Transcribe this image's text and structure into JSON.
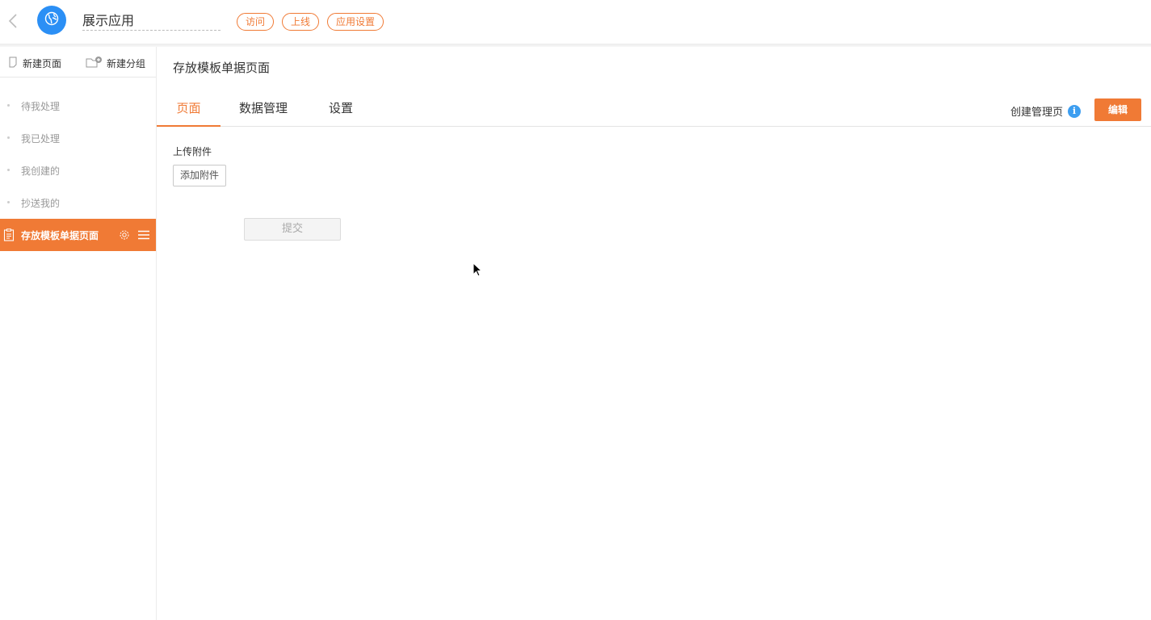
{
  "header": {
    "app_name": "展示应用",
    "pills": [
      {
        "label": "访问"
      },
      {
        "label": "上线"
      },
      {
        "label": "应用设置"
      }
    ]
  },
  "sidebar": {
    "new_page": "新建页面",
    "new_group": "新建分组",
    "items": [
      {
        "label": "待我处理"
      },
      {
        "label": "我已处理"
      },
      {
        "label": "我创建的"
      },
      {
        "label": "抄送我的"
      },
      {
        "label": "存放模板单据页面"
      }
    ]
  },
  "main": {
    "page_title": "存放模板单据页面",
    "tabs": [
      {
        "label": "页面"
      },
      {
        "label": "数据管理"
      },
      {
        "label": "设置"
      }
    ],
    "create_manage_label": "创建管理页",
    "info_glyph": "i",
    "edit_label": "编辑",
    "form": {
      "upload_label": "上传附件",
      "add_attachment": "添加附件",
      "submit": "提交"
    }
  },
  "colors": {
    "accent": "#f07a35",
    "logo_blue": "#2b8ff5",
    "info_blue": "#3d9ef0"
  },
  "icons": [
    "chevron-left-icon",
    "globe-icon",
    "new-page-icon",
    "new-folder-icon",
    "document-icon",
    "gear-icon",
    "menu-icon",
    "info-icon",
    "cursor-icon"
  ]
}
